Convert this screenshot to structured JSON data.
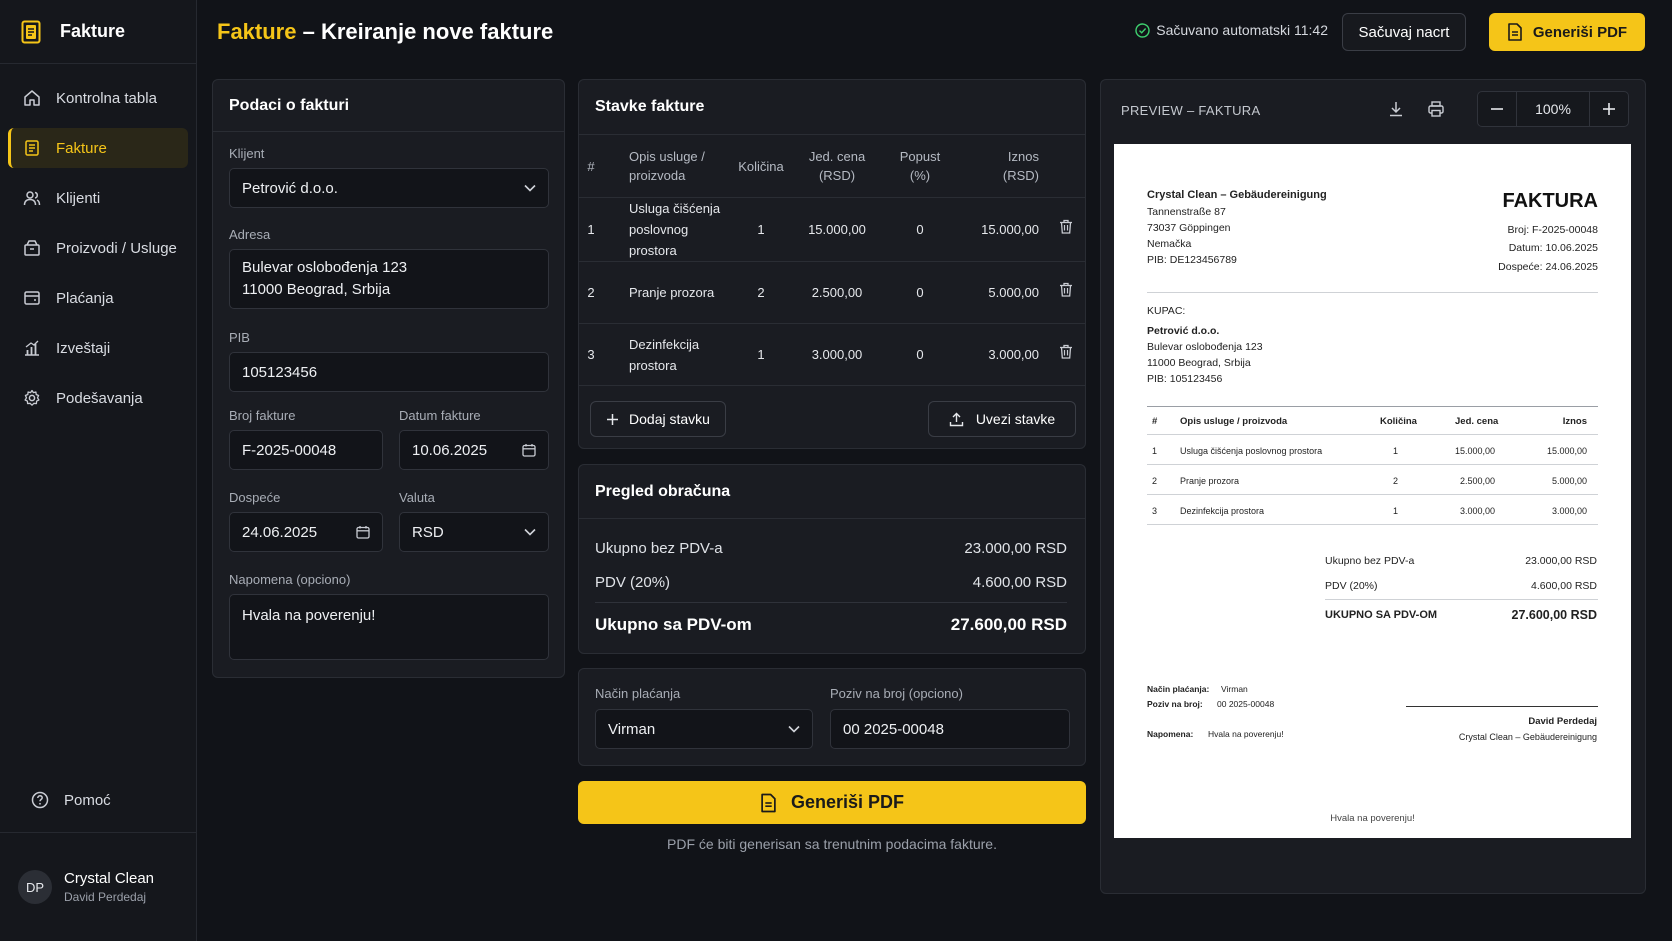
{
  "app": {
    "name": "Fakture"
  },
  "sidebar": {
    "items": [
      {
        "label": "Kontrolna tabla",
        "icon": "home-icon"
      },
      {
        "label": "Fakture",
        "icon": "invoice-icon",
        "active": true
      },
      {
        "label": "Klijenti",
        "icon": "users-icon"
      },
      {
        "label": "Proizvodi / Usluge",
        "icon": "package-icon"
      },
      {
        "label": "Plaćanja",
        "icon": "wallet-icon"
      },
      {
        "label": "Izveštaji",
        "icon": "chart-icon"
      },
      {
        "label": "Podešavanja",
        "icon": "gear-icon"
      }
    ],
    "help": "Pomoć",
    "user": {
      "initials": "DP",
      "company": "Crystal Clean",
      "name": "David Perdedaj"
    }
  },
  "header": {
    "title_prefix": "Fakture",
    "title_rest": " – Kreiranje nove fakture",
    "autosave": "Sačuvano automatski 11:42",
    "save_draft": "Sačuvaj nacrt",
    "generate": "Generiši PDF"
  },
  "colors": {
    "accent": "#f5c518",
    "background": "#111318",
    "panel": "#1a1c22"
  },
  "invoice_form": {
    "title": "Podaci o fakturi",
    "client_label": "Klijent",
    "client": "Petrović d.o.o.",
    "address_label": "Adresa",
    "address_line1": "Bulevar oslobođenja 123",
    "address_line2": "11000 Beograd, Srbija",
    "pib_label": "PIB",
    "pib": "105123456",
    "number_label": "Broj fakture",
    "number": "F-2025-00048",
    "date_label": "Datum fakture",
    "date": "10.06.2025",
    "due_label": "Dospeće",
    "due": "24.06.2025",
    "currency_label": "Valuta",
    "currency": "RSD",
    "note_label": "Napomena (opciono)",
    "note": "Hvala na poverenju!"
  },
  "items": {
    "title": "Stavke fakture",
    "headers": {
      "num": "#",
      "desc1": "Opis usluge /",
      "desc2": "proizvoda",
      "qty": "Količina",
      "price1": "Jed. cena",
      "price2": "(RSD)",
      "disc1": "Popust",
      "disc2": "(%)",
      "amount1": "Iznos",
      "amount2": "(RSD)"
    },
    "rows": [
      {
        "num": "1",
        "desc1": "Usluga čišćenja",
        "desc2": "poslovnog prostora",
        "qty": "1",
        "price": "15.000,00",
        "disc": "0",
        "amount": "15.000,00"
      },
      {
        "num": "2",
        "desc1": "Pranje prozora",
        "desc2": "",
        "qty": "2",
        "price": "2.500,00",
        "disc": "0",
        "amount": "5.000,00"
      },
      {
        "num": "3",
        "desc1": "Dezinfekcija",
        "desc2": "prostora",
        "qty": "1",
        "price": "3.000,00",
        "disc": "0",
        "amount": "3.000,00"
      }
    ],
    "add": "Dodaj stavku",
    "import": "Uvezi stavke"
  },
  "summary": {
    "title": "Pregled obračuna",
    "subtotal_label": "Ukupno bez PDV-a",
    "subtotal": "23.000,00 RSD",
    "vat_label": "PDV (20%)",
    "vat": "4.600,00 RSD",
    "total_label": "Ukupno sa PDV-om",
    "total": "27.600,00 RSD"
  },
  "payment": {
    "method_label": "Način plaćanja",
    "method": "Virman",
    "ref_label": "Poziv na broj (opciono)",
    "ref": "00 2025-00048"
  },
  "generate_big": "Generiši PDF",
  "generate_hint": "PDF će biti generisan sa trenutnim podacima fakture.",
  "preview": {
    "label": "PREVIEW – FAKTURA",
    "zoom": "100%",
    "doc": {
      "company": "Crystal Clean – Gebäudereinigung",
      "street": "Tannenstraße 87",
      "city": "73037 Göppingen",
      "country": "Nemačka",
      "pib": "PIB: DE123456789",
      "heading": "FAKTURA",
      "number": "Broj: F-2025-00048",
      "date": "Datum: 10.06.2025",
      "due": "Dospeće: 24.06.2025",
      "buyer_label": "KUPAC:",
      "buyer_name": "Petrović d.o.o.",
      "buyer_street": "Bulevar oslobođenja 123",
      "buyer_city": "11000 Beograd, Srbija",
      "buyer_pib": "PIB: 105123456",
      "th_num": "#",
      "th_desc": "Opis usluge / proizvoda",
      "th_qty": "Količina",
      "th_price": "Jed. cena",
      "th_amount": "Iznos",
      "rows": [
        {
          "num": "1",
          "desc": "Usluga čišćenja poslovnog prostora",
          "qty": "1",
          "price": "15.000,00",
          "amount": "15.000,00"
        },
        {
          "num": "2",
          "desc": "Pranje prozora",
          "qty": "2",
          "price": "2.500,00",
          "amount": "5.000,00"
        },
        {
          "num": "3",
          "desc": "Dezinfekcija prostora",
          "qty": "1",
          "price": "3.000,00",
          "amount": "3.000,00"
        }
      ],
      "subtotal_label": "Ukupno bez PDV-a",
      "subtotal": "23.000,00 RSD",
      "vat_label": "PDV (20%)",
      "vat": "4.600,00 RSD",
      "total_label": "UKUPNO SA PDV-OM",
      "total": "27.600,00 RSD",
      "pay_label": "Način plaćanja:",
      "pay": "Virman",
      "ref_label": "Poziv na broj:",
      "ref": "00 2025-00048",
      "note_label": "Napomena:",
      "note": "Hvala na poverenju!",
      "sign_name": "David Perdedaj",
      "sign_company": "Crystal Clean – Gebäudereinigung",
      "footer": "Hvala na poverenju!"
    }
  }
}
